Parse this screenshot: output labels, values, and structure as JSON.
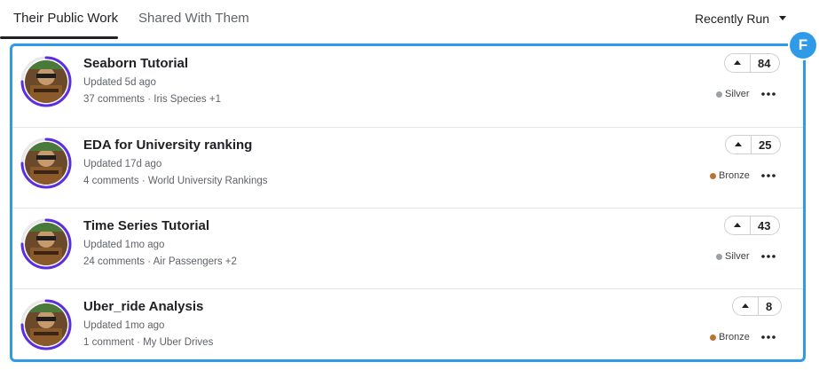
{
  "tabs": [
    {
      "label": "Their Public Work",
      "active": true
    },
    {
      "label": "Shared With Them",
      "active": false
    }
  ],
  "sort": {
    "label": "Recently Run"
  },
  "highlight_badge": "F",
  "notebooks": [
    {
      "title": "Seaborn Tutorial",
      "updated": "Updated 5d ago",
      "meta": "37 comments · Iris Species +1",
      "votes": "84",
      "medal": "Silver",
      "medal_color": "#9aa0a6"
    },
    {
      "title": "EDA for University ranking",
      "updated": "Updated 17d ago",
      "meta": "4 comments · World University Rankings",
      "votes": "25",
      "medal": "Bronze",
      "medal_color": "#b87333"
    },
    {
      "title": "Time Series Tutorial",
      "updated": "Updated 1mo ago",
      "meta": "24 comments · Air Passengers +2",
      "votes": "43",
      "medal": "Silver",
      "medal_color": "#9aa0a6"
    },
    {
      "title": "Uber_ride Analysis",
      "updated": "Updated 1mo ago",
      "meta": "1 comment · My Uber Drives",
      "votes": "8",
      "medal": "Bronze",
      "medal_color": "#b87333"
    }
  ],
  "colors": {
    "accent": "#2f9ae8",
    "progress_ring": "#5c2ee0"
  }
}
